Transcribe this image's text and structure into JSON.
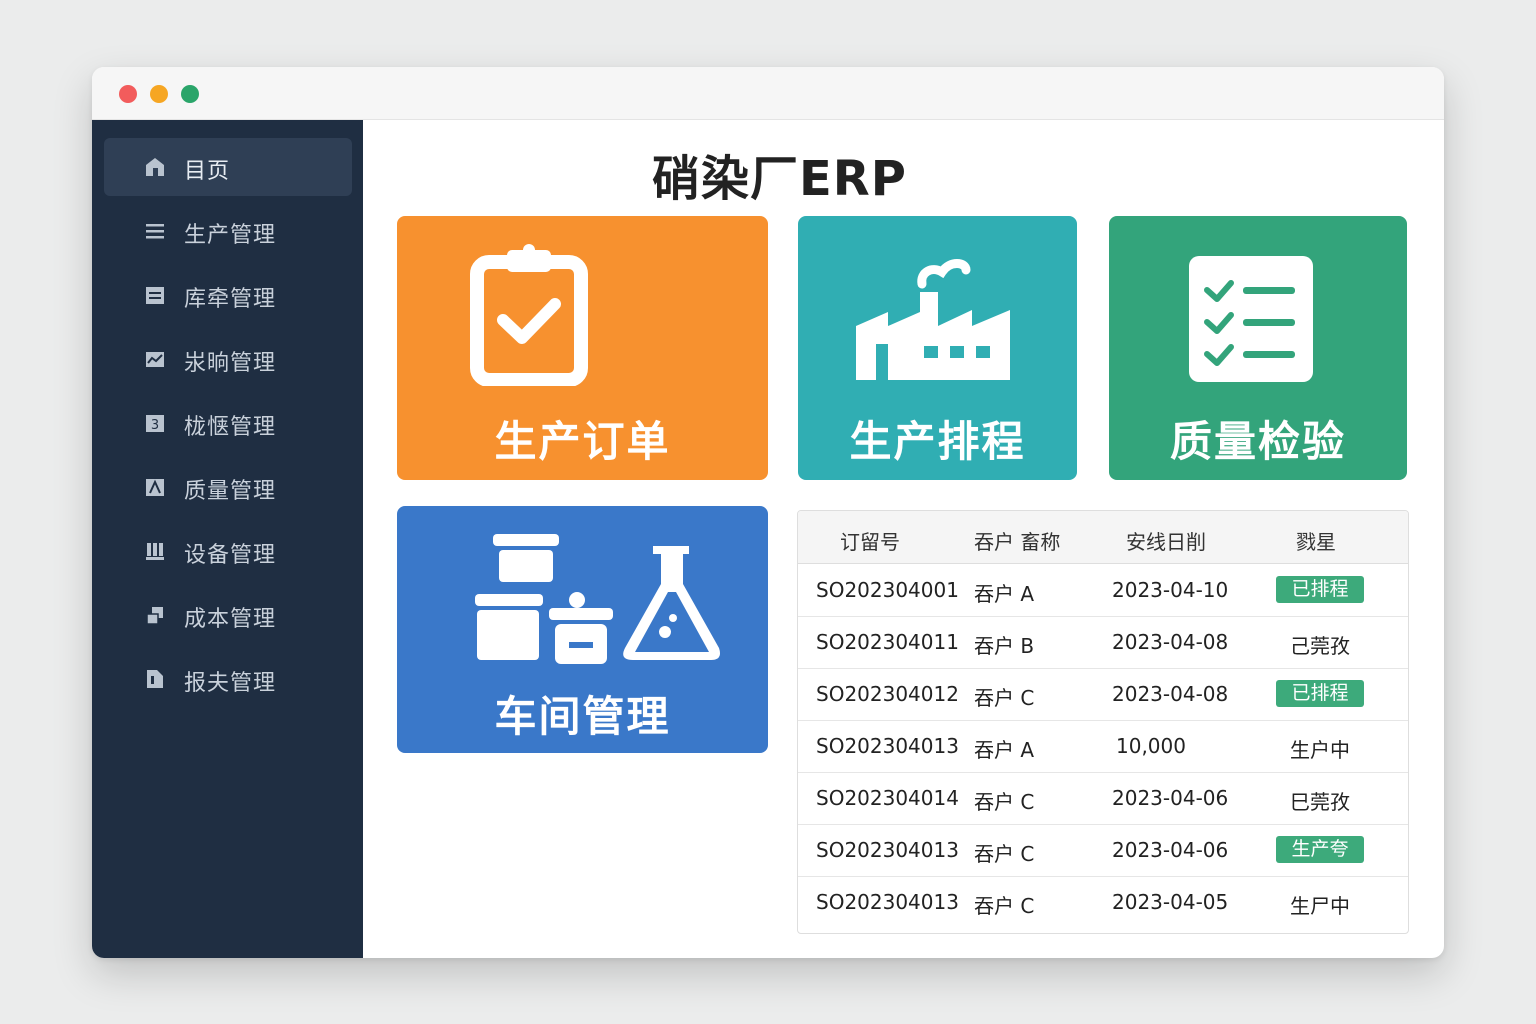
{
  "app": {
    "title": "硝染厂ERP"
  },
  "sidebar": {
    "items": [
      {
        "label": "目页",
        "icon": "home-icon"
      },
      {
        "label": "生产管理",
        "icon": "menu-icon"
      },
      {
        "label": "库牵管理",
        "icon": "inventory-icon"
      },
      {
        "label": "汖晌管理",
        "icon": "purchase-icon"
      },
      {
        "label": "栊惬管理",
        "icon": "calendar-icon"
      },
      {
        "label": "质量管理",
        "icon": "quality-icon"
      },
      {
        "label": "设备管理",
        "icon": "equipment-icon"
      },
      {
        "label": "成本管理",
        "icon": "cost-icon"
      },
      {
        "label": "报夫管理",
        "icon": "report-icon"
      }
    ]
  },
  "tiles": {
    "production_orders": {
      "label": "生产订单",
      "color": "#f7912f",
      "icon": "clipboard-check-icon"
    },
    "production_schedule": {
      "label": "生产排程",
      "color": "#30aeb3",
      "icon": "factory-icon"
    },
    "quality_inspection": {
      "label": "质量检验",
      "color": "#33a47b",
      "icon": "checklist-icon"
    },
    "workshop_management": {
      "label": "车间管理",
      "color": "#3a78c9",
      "icon": "lab-containers-icon"
    }
  },
  "orders_table": {
    "columns": [
      "订留号",
      "吞户 畜称",
      "安线日削",
      "戮星"
    ],
    "rows": [
      {
        "order": "SO202304001",
        "customer": "吞户 A",
        "date": "2023-04-10",
        "status": "已排程",
        "badge": true
      },
      {
        "order": "SO202304011",
        "customer": "吞户 B",
        "date": "2023-04-08",
        "status": "己莞孜",
        "badge": false
      },
      {
        "order": "SO202304012",
        "customer": "吞户 C",
        "date": "2023-04-08",
        "status": "已排程",
        "badge": true
      },
      {
        "order": "SO202304013",
        "customer": "吞户 A",
        "date": "10,000",
        "status": "生户中",
        "badge": false
      },
      {
        "order": "SO202304014",
        "customer": "吞户 C",
        "date": "2023-04-06",
        "status": "巳莞孜",
        "badge": false
      },
      {
        "order": "SO202304013",
        "customer": "吞户 C",
        "date": "2023-04-06",
        "status": "生产夸",
        "badge": true
      },
      {
        "order": "SO202304013",
        "customer": "吞户 C",
        "date": "2023-04-05",
        "status": "生尸中",
        "badge": false
      }
    ]
  },
  "colors": {
    "sidebar": "#1f2e42",
    "badge": "#3daa7b"
  }
}
